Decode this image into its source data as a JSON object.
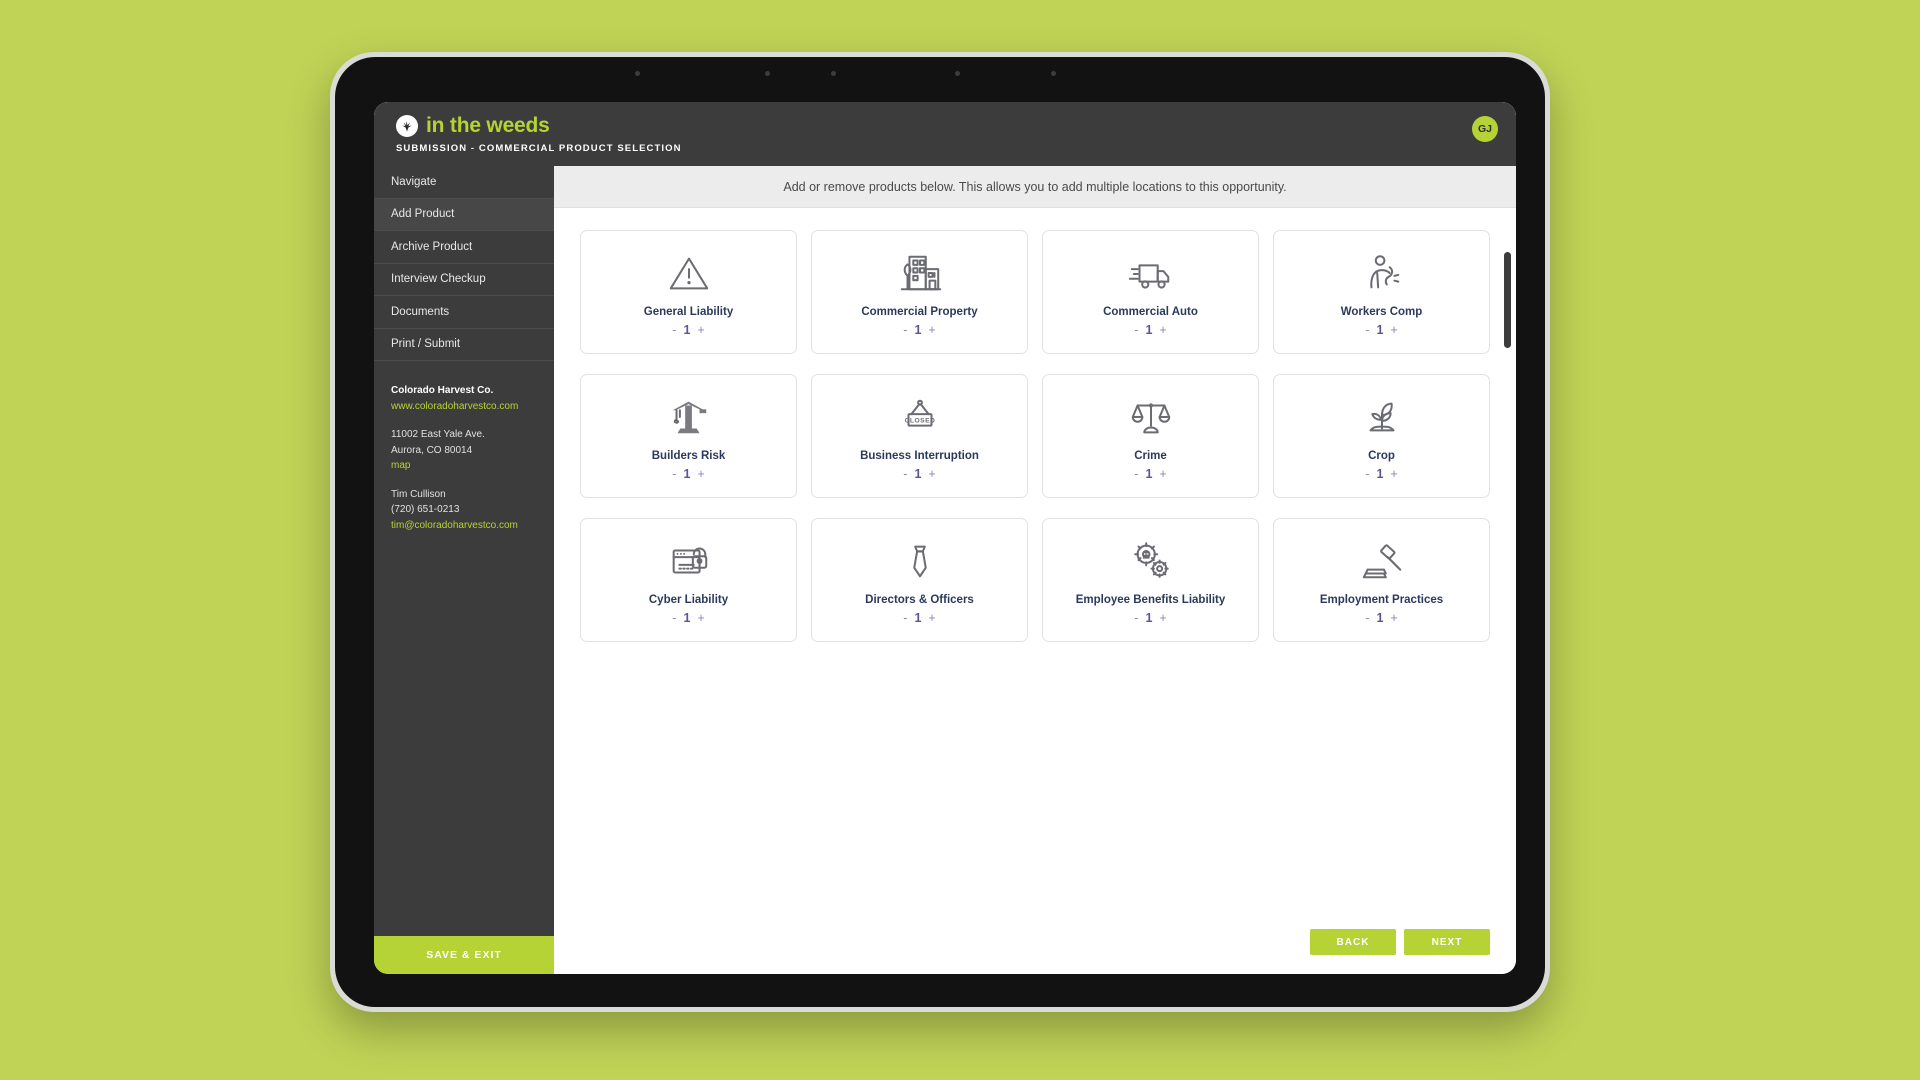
{
  "theme": {
    "page_background": "#c0d356",
    "brand_green": "#b6d335",
    "header_dark": "#3c3c3c",
    "card_label_blue": "#2b3a5c",
    "stepper_purple": "#5f51a0"
  },
  "header": {
    "logo_icon": "weed-plant-logo-icon",
    "brand": "in the weeds",
    "breadcrumb": "SUBMISSION - COMMERCIAL PRODUCT SELECTION",
    "avatar_initials": "GJ"
  },
  "sidebar": {
    "items": [
      {
        "label": "Navigate",
        "active": false
      },
      {
        "label": "Add Product",
        "active": true
      },
      {
        "label": "Archive Product",
        "active": false
      },
      {
        "label": "Interview Checkup",
        "active": false
      },
      {
        "label": "Documents",
        "active": false
      },
      {
        "label": "Print / Submit",
        "active": false
      }
    ],
    "contact": {
      "company": "Colorado Harvest Co.",
      "website": "www.coloradoharvestco.com",
      "street": "11002 East Yale Ave.",
      "city_state_zip": "Aurora, CO 80014",
      "map_link": "map",
      "contact_name": "Tim Cullison",
      "phone": "(720) 651-0213",
      "email": "tim@coloradoharvestco.com"
    },
    "save_exit_label": "SAVE & EXIT"
  },
  "main": {
    "instruction": "Add or remove products below. This allows you to add multiple locations to this opportunity.",
    "products": [
      {
        "label": "General Liability",
        "icon": "warning-triangle-icon",
        "quantity": "1"
      },
      {
        "label": "Commercial Property",
        "icon": "office-building-icon",
        "quantity": "1"
      },
      {
        "label": "Commercial Auto",
        "icon": "delivery-truck-icon",
        "quantity": "1"
      },
      {
        "label": "Workers Comp",
        "icon": "back-injury-icon",
        "quantity": "1"
      },
      {
        "label": "Builders Risk",
        "icon": "crane-icon",
        "quantity": "1"
      },
      {
        "label": "Business Interruption",
        "icon": "closed-sign-icon",
        "quantity": "1"
      },
      {
        "label": "Crime",
        "icon": "scales-of-justice-icon",
        "quantity": "1"
      },
      {
        "label": "Crop",
        "icon": "seedling-icon",
        "quantity": "1"
      },
      {
        "label": "Cyber Liability",
        "icon": "browser-lock-icon",
        "quantity": "1"
      },
      {
        "label": "Directors & Officers",
        "icon": "necktie-icon",
        "quantity": "1"
      },
      {
        "label": "Employee Benefits Liability",
        "icon": "gears-person-icon",
        "quantity": "1"
      },
      {
        "label": "Employment Practices",
        "icon": "gavel-icon",
        "quantity": "1"
      }
    ],
    "stepper": {
      "decrement": "-",
      "increment": "+"
    },
    "footer": {
      "back_label": "BACK",
      "next_label": "NEXT"
    }
  }
}
